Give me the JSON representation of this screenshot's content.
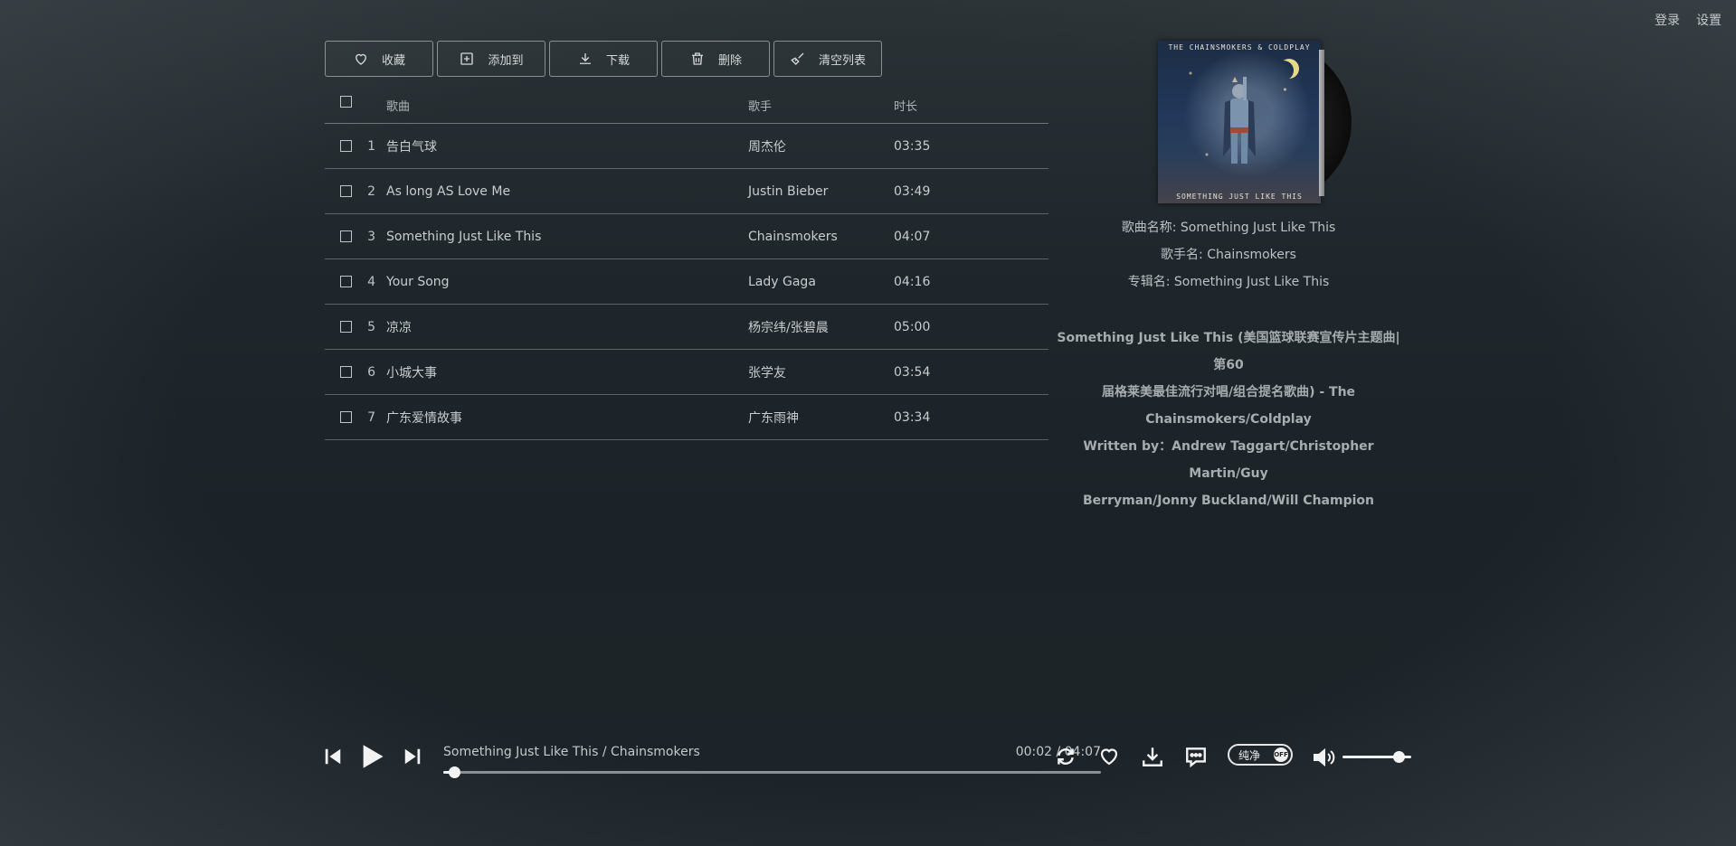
{
  "top_links": {
    "login": "登录",
    "settings": "设置"
  },
  "toolbar": {
    "favorite": "收藏",
    "add_to": "添加到",
    "download": "下载",
    "delete": "删除",
    "clear_list": "清空列表"
  },
  "list": {
    "headers": {
      "title": "歌曲",
      "artist": "歌手",
      "duration": "时长"
    },
    "rows": [
      {
        "num": "1",
        "title": "告白气球",
        "artist": "周杰伦",
        "duration": "03:35"
      },
      {
        "num": "2",
        "title": "As long AS Love Me",
        "artist": "Justin Bieber",
        "duration": "03:49"
      },
      {
        "num": "3",
        "title": "Something Just Like This",
        "artist": "Chainsmokers",
        "duration": "04:07"
      },
      {
        "num": "4",
        "title": "Your Song",
        "artist": "Lady Gaga",
        "duration": "04:16"
      },
      {
        "num": "5",
        "title": "凉凉",
        "artist": "杨宗纬/张碧晨",
        "duration": "05:00"
      },
      {
        "num": "6",
        "title": "小城大事",
        "artist": "张学友",
        "duration": "03:54"
      },
      {
        "num": "7",
        "title": "广东爱情故事",
        "artist": "广东雨神",
        "duration": "03:34"
      }
    ]
  },
  "now_playing": {
    "cover_top_text": "THE CHAINSMOKERS & COLDPLAY",
    "cover_bottom_text": "SOMETHING JUST LIKE THIS",
    "song_name": "歌曲名称: Something Just Like This",
    "artist_name": "歌手名: Chainsmokers",
    "album_name": "专辑名: Something Just Like This",
    "lyrics": [
      "Something Just Like This (美国篮球联赛宣传片主题曲|第60",
      "届格莱美最佳流行对唱/组合提名歌曲) - The",
      "Chainsmokers/Coldplay",
      "Written by：Andrew Taggart/Christopher Martin/Guy",
      "Berryman/Jonny Buckland/Will Champion"
    ]
  },
  "player": {
    "track_line": "Something Just Like This / Chainsmokers",
    "time": "00:02 / 04:07",
    "progress": 0.016,
    "pure_mode_label": "纯净",
    "pure_mode_state": "OFF",
    "volume": 0.82
  },
  "icons": {
    "prev": "skip-back-icon",
    "play": "play-icon",
    "next": "skip-forward-icon",
    "loop": "repeat-icon",
    "like": "heart-icon",
    "download": "download-icon",
    "comment": "comment-icon",
    "volume": "volume-icon"
  }
}
